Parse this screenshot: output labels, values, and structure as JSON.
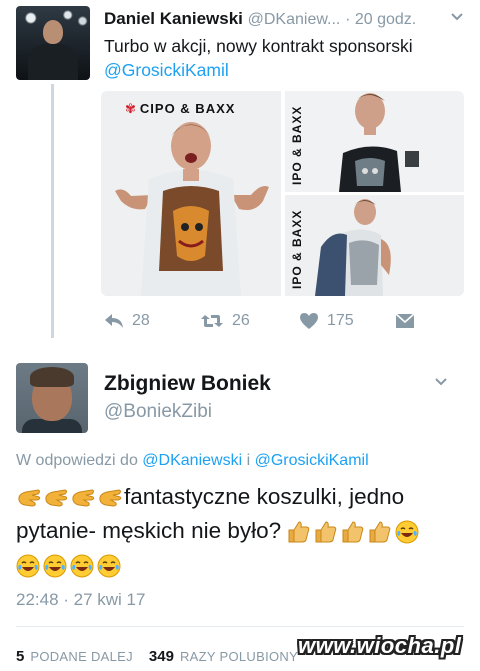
{
  "tweet": {
    "name": "Daniel Kaniewski",
    "handle": "@DKaniew...",
    "time": "· 20 godz.",
    "text_plain": "Turbo w akcji, nowy kontrakt sponsorski",
    "text_mention": "@GrosickiKamil",
    "media": {
      "brand_main": "CIPO & BAXX",
      "brand_side": "IPO & BAXX"
    },
    "actions": {
      "reply_icon": "reply-icon",
      "reply_count": "28",
      "retweet_icon": "retweet-icon",
      "retweet_count": "26",
      "like_icon": "heart-icon",
      "like_count": "175",
      "dm_icon": "envelope-icon"
    }
  },
  "reply": {
    "name": "Zbigniew Boniek",
    "handle": "@BoniekZibi",
    "reply_prefix": "W odpowiedzi do",
    "reply_to_1": "@DKaniewski",
    "reply_joiner": "i",
    "reply_to_2": "@GrosickiKamil",
    "text_line1": "fantastyczne koszulki, jedno",
    "text_line2": "pytanie- męskich nie było?",
    "emoji_leading": "clapping-hands-emoji",
    "emoji_thumbs": "thumbs-up-emoji",
    "emoji_laugh": "tears-of-joy-emoji",
    "timestamp": "22:48 · 27 kwi 17",
    "retweets_count": "5",
    "retweets_label": "PODANE DALEJ",
    "likes_count": "349",
    "likes_label": "RAZY POLUBIONY"
  },
  "watermark": "www.wiocha.pl",
  "colors": {
    "link": "#1da1f2",
    "muted": "#8899a6",
    "text": "#14171a",
    "brand_logo": "#d4202c"
  }
}
